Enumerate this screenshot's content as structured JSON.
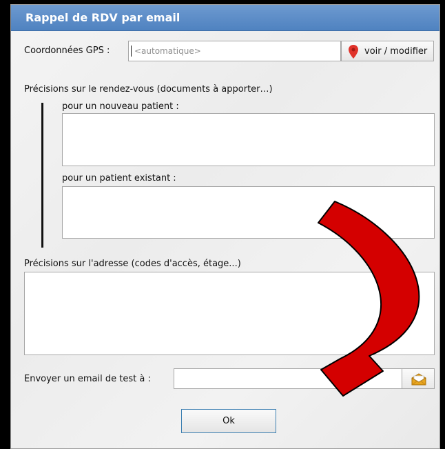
{
  "dialog": {
    "title": "Rappel de RDV par email",
    "title_bar_color": "#5a8ac7"
  },
  "gps": {
    "label": "Coordonnées GPS :",
    "placeholder": "<automatique>",
    "value": "",
    "button_label": "voir / modifier",
    "pin_icon": "map-pin-icon",
    "pin_color": "#e0322a"
  },
  "appointment": {
    "section_label": "Précisions sur le rendez-vous (documents à apporter…)",
    "new_patient_label": "pour un nouveau patient :",
    "new_patient_value": "",
    "existing_patient_label": "pour un patient existant :",
    "existing_patient_value": ""
  },
  "address": {
    "label": "Précisions sur l'adresse (codes d'accès, étage...)",
    "value": ""
  },
  "test_email": {
    "label": "Envoyer un email de test à :",
    "value": "",
    "button_icon": "envelope-icon"
  },
  "footer": {
    "ok_label": "Ok"
  },
  "annotation": {
    "arrow_color": "#d40000"
  }
}
